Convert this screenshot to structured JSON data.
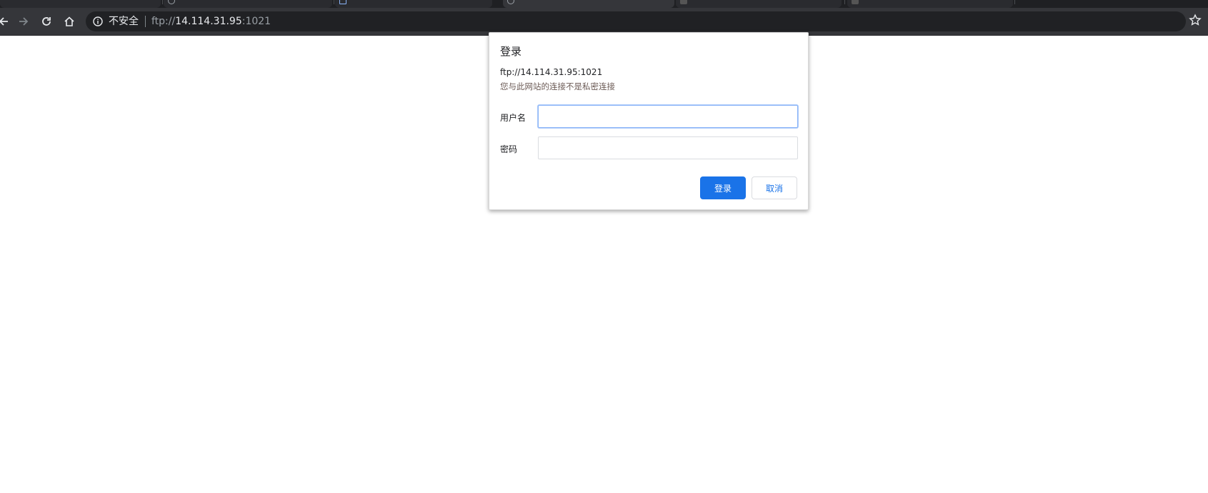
{
  "browser": {
    "security_label": "不安全",
    "url": {
      "scheme": "ftp://",
      "host": "14.114.31.95",
      "port": ":1021"
    }
  },
  "dialog": {
    "title": "登录",
    "origin": "ftp://14.114.31.95:1021",
    "warning": "您与此网站的连接不是私密连接",
    "username_label": "用户名",
    "username_value": "",
    "password_label": "密码",
    "password_value": "",
    "sign_in_button": "登录",
    "cancel_button": "取消"
  }
}
